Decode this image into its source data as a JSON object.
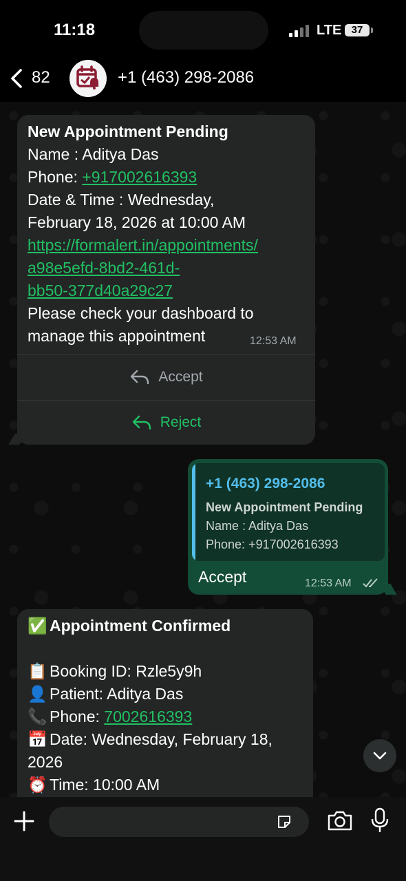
{
  "status_bar": {
    "time": "11:18",
    "network": "LTE",
    "battery": "37"
  },
  "header": {
    "back_count": "82",
    "contact_name": "+1 (463) 298-2086"
  },
  "messages": [
    {
      "title": "New Appointment Pending",
      "name_line": "Name : Aditya Das",
      "phone_label": "Phone: ",
      "phone_link": "+917002616393",
      "datetime_line1": "Date & Time : Wednesday,",
      "datetime_line2": "February 18, 2026 at 10:00 AM",
      "url_line1": "https://formalert.in/appointments/",
      "url_line2": "a98e5efd-8bd2-461d-",
      "url_line3": "bb50-377d40a29c27",
      "footer_line1": "Please check your dashboard to",
      "footer_line2": "manage this appointment",
      "time": "12:53 AM",
      "actions": [
        "Accept",
        "Reject"
      ]
    },
    {
      "quoted": {
        "sender": "+1 (463) 298-2086",
        "title": "New Appointment Pending",
        "line1": "Name : Aditya Das",
        "line2": "Phone: +917002616393"
      },
      "text": "Accept",
      "time": "12:53 AM"
    },
    {
      "title_emoji": "✅",
      "title": "Appointment Confirmed",
      "booking_emoji": "📋",
      "booking": "Booking ID: Rzle5y9h",
      "patient_emoji": "👤",
      "patient": "Patient: Aditya Das",
      "phone_emoji": "📞",
      "phone_label": "Phone: ",
      "phone_link": "7002616393",
      "date_emoji": "📅",
      "date_line1": "Date: Wednesday, February 18,",
      "date_line2": "2026",
      "time_emoji": "⏰",
      "time_line": "Time: 10:00 AM"
    }
  ],
  "colors": {
    "link": "#21c063",
    "bubble_in": "#242626",
    "bubble_out": "#144d37",
    "quote_accent": "#53bdeb"
  },
  "icons": [
    "back-chevron-icon",
    "calendar-alert-icon",
    "reply-icon",
    "double-check-icon",
    "plus-icon",
    "sticker-icon",
    "camera-icon",
    "mic-icon",
    "chevron-down-icon"
  ]
}
